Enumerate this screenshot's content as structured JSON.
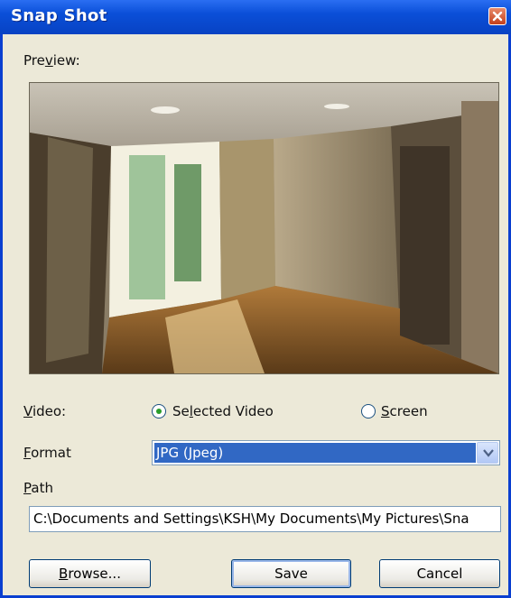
{
  "window": {
    "title": "Snap Shot"
  },
  "preview": {
    "label_pre": "Pre",
    "label_ul": "v",
    "label_post": "iew:"
  },
  "video": {
    "label_ul": "V",
    "label_post": "ideo:",
    "option_selected": {
      "pre": "Se",
      "ul": "l",
      "post": "ected Video"
    },
    "option_screen": {
      "pre": "",
      "ul": "S",
      "post": "creen"
    }
  },
  "format": {
    "label_ul": "F",
    "label_post": "ormat",
    "value": "JPG (Jpeg)"
  },
  "path": {
    "label_ul": "P",
    "label_post": "ath",
    "value": "C:\\Documents and Settings\\KSH\\My Documents\\My Pictures\\Sna"
  },
  "buttons": {
    "browse_ul": "B",
    "browse_post": "rowse...",
    "save": "Save",
    "cancel": "Cancel"
  }
}
